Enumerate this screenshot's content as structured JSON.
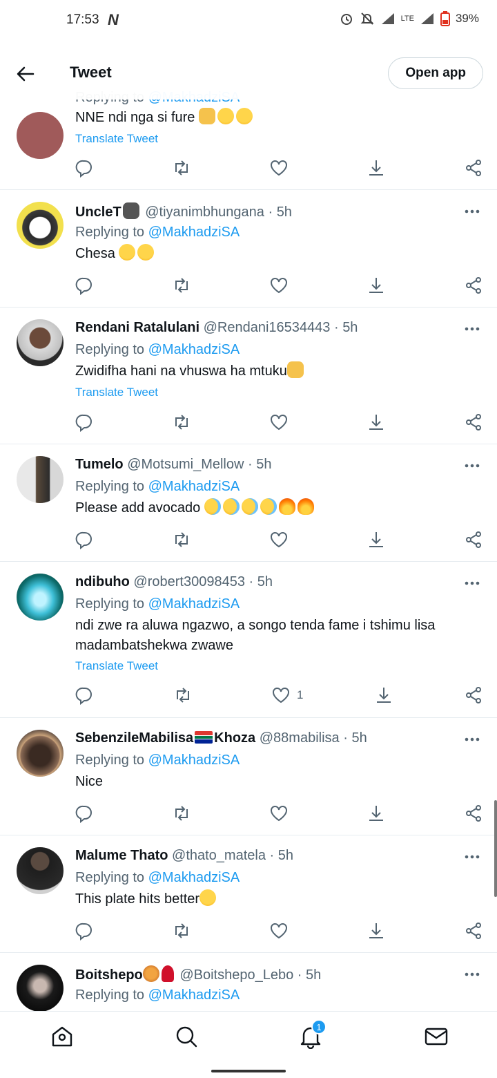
{
  "status": {
    "time": "17:53",
    "battery": "39%",
    "network": "LTE"
  },
  "header": {
    "title": "Tweet",
    "open_app": "Open app"
  },
  "partial_tweet": {
    "reply_prefix": "Replying to",
    "mention": "@MakhadziSA",
    "text": "NNE ndi nga si fure",
    "translate": "Translate Tweet"
  },
  "tweets": [
    {
      "name": "UncleT",
      "handle": "@tiyanimbhungana",
      "time": "5h",
      "reply_prefix": "Replying to",
      "mention": "@MakhadziSA",
      "text": "Chesa",
      "translate": "",
      "likes": ""
    },
    {
      "name": "Rendani Ratalulani",
      "handle": "@Rendani16534443",
      "time": "5h",
      "reply_prefix": "Replying to",
      "mention": "@MakhadziSA",
      "text": "Zwidifha hani na vhuswa ha mtuku",
      "translate": "Translate Tweet",
      "likes": ""
    },
    {
      "name": "Tumelo",
      "handle": "@Motsumi_Mellow",
      "time": "5h",
      "reply_prefix": "Replying to",
      "mention": "@MakhadziSA",
      "text": "Please add avocado",
      "translate": "",
      "likes": ""
    },
    {
      "name": "ndibuho",
      "handle": "@robert30098453",
      "time": "5h",
      "reply_prefix": "Replying to",
      "mention": "@MakhadziSA",
      "text": "ndi zwe ra aluwa ngazwo, a songo tenda fame i tshimu lisa madambatshekwa zwawe",
      "translate": "Translate Tweet",
      "likes": "1"
    },
    {
      "name": "SebenzileMabilisa",
      "name2": "Khoza",
      "handle": "@88mabilisa",
      "time": "5h",
      "reply_prefix": "Replying to",
      "mention": "@MakhadziSA",
      "text": "Nice",
      "translate": "",
      "likes": ""
    },
    {
      "name": "Malume Thato",
      "handle": "@thato_matela",
      "time": "5h",
      "reply_prefix": "Replying to",
      "mention": "@MakhadziSA",
      "text": "This plate hits better",
      "translate": "",
      "likes": ""
    },
    {
      "name": "Boitshepo",
      "handle": "@Boitshepo_Lebo",
      "time": "5h",
      "reply_prefix": "Replying to",
      "mention": "@MakhadziSA",
      "text": "",
      "translate": "",
      "likes": ""
    }
  ],
  "nav": {
    "notifications_badge": "1"
  },
  "icons": [
    "back-arrow-icon",
    "reply-icon",
    "retweet-icon",
    "like-icon",
    "bookmark-download-icon",
    "share-icon",
    "more-icon",
    "home-icon",
    "search-icon",
    "bell-icon",
    "mail-icon"
  ],
  "colors": {
    "accent": "#1d9bf0",
    "secondary_text": "#536471",
    "primary_text": "#0f1419"
  }
}
